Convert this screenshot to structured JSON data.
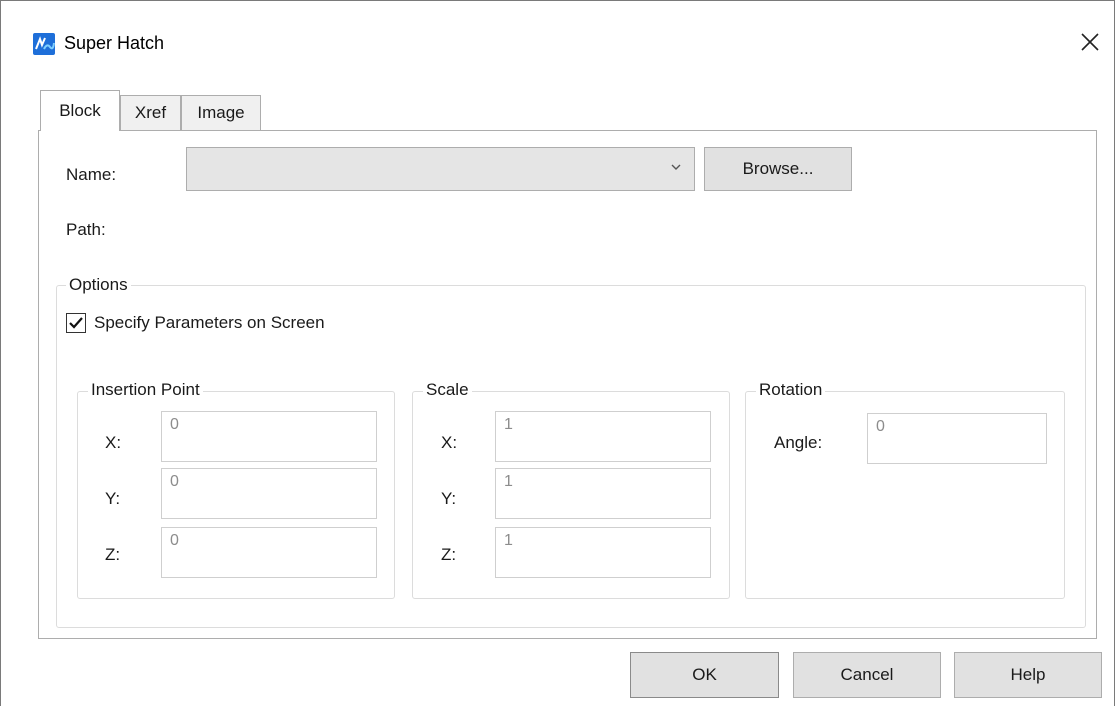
{
  "window": {
    "title": "Super Hatch",
    "close_glyph": "✕"
  },
  "tabs": [
    {
      "label": "Block",
      "active": true
    },
    {
      "label": "Xref",
      "active": false
    },
    {
      "label": "Image",
      "active": false
    }
  ],
  "block": {
    "name_label": "Name:",
    "name_value": "",
    "browse_label": "Browse...",
    "path_label": "Path:",
    "options": {
      "caption": "Options",
      "specify_label": "Specify Parameters on Screen",
      "specify_checked": true,
      "insertion": {
        "caption": "Insertion Point",
        "x_label": "X:",
        "x_value": "0",
        "y_label": "Y:",
        "y_value": "0",
        "z_label": "Z:",
        "z_value": "0"
      },
      "scale": {
        "caption": "Scale",
        "x_label": "X:",
        "x_value": "1",
        "y_label": "Y:",
        "y_value": "1",
        "z_label": "Z:",
        "z_value": "1"
      },
      "rotation": {
        "caption": "Rotation",
        "angle_label": "Angle:",
        "angle_value": "0"
      }
    }
  },
  "footer": {
    "ok_label": "OK",
    "cancel_label": "Cancel",
    "help_label": "Help"
  },
  "icons": {
    "app": "super-hatch-app-icon",
    "close": "close-icon",
    "dropdown": "chevron-down-icon",
    "check": "checkmark-icon"
  },
  "colors": {
    "icon_blue": "#1e6fd9",
    "button_bg": "#e1e1e1",
    "combo_bg": "#e5e5e5",
    "disabled_text": "#8c8c8c"
  }
}
